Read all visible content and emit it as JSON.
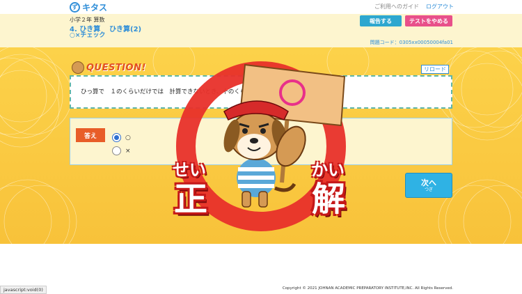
{
  "header": {
    "logo_text": "キタス",
    "logo_mark": "ず",
    "guide_link": "ご利用へのガイド",
    "logout_link": "ログアウト"
  },
  "lesson": {
    "grade": "小学２年 算数",
    "unit_no": "4. ひき算",
    "unit_name": "ひき算(2)",
    "mode": "○×チェック",
    "report_button": "報告する",
    "quit_button": "テストをやめる",
    "question_code": "問題コード：0305xx00050004fa01"
  },
  "question": {
    "badge": "QUESTION!",
    "reload_button": "リロード",
    "text": "ひっ算で　１のくらいだけでは　計算できないとき、十のくらいから１くり下げる。"
  },
  "answer": {
    "label": "答え",
    "options": [
      {
        "mark": "○",
        "selected": true
      },
      {
        "mark": "×",
        "selected": false
      }
    ]
  },
  "next_button": {
    "main": "次へ",
    "ruby": "つぎ"
  },
  "result": {
    "ruby_left": "せい",
    "kanji_left": "正",
    "ruby_right": "かい",
    "kanji_right": "解",
    "sign_mark": "○"
  },
  "footer": {
    "copyright": "Copyright © 2021 JOHNAN ACADEMIC PREPARATORY INSTITUTE,INC. All Rights Reserved.",
    "status": "javascript:void(0)"
  },
  "colors": {
    "accent_blue": "#2f8ed8",
    "stage_yellow": "#fcd24a",
    "ring_red": "#e8302a",
    "quit_pink": "#e8508a"
  }
}
